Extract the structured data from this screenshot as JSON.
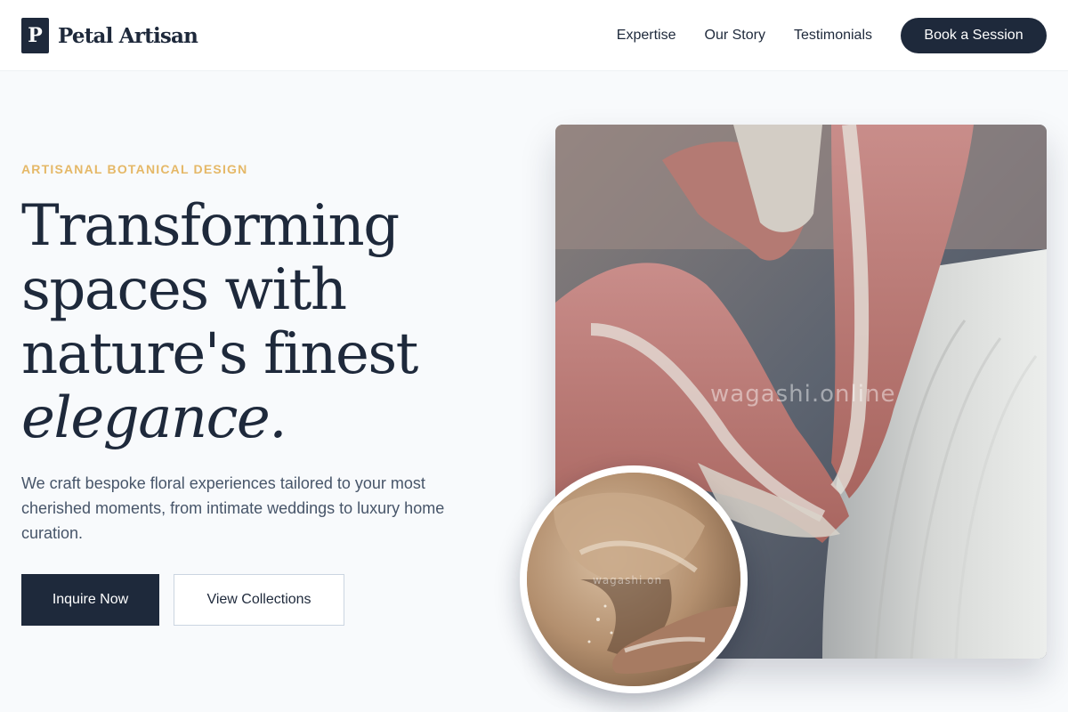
{
  "brand": {
    "logo_letter": "P",
    "name": "Petal Artisan"
  },
  "nav": {
    "links": [
      "Expertise",
      "Our Story",
      "Testimonials"
    ],
    "cta_label": "Book a Session"
  },
  "hero": {
    "eyebrow": "ARTISANAL BOTANICAL DESIGN",
    "headline_lines": [
      "Transforming",
      "spaces with",
      "nature's finest"
    ],
    "headline_emphasis": "elegance.",
    "lead": "We craft bespoke floral experiences tailored to your most cherished moments, from intimate weddings to luxury home curation.",
    "primary_button": "Inquire Now",
    "secondary_button": "View Collections",
    "main_image_watermark": "wagashi.online",
    "inset_image_watermark": "wagashi.on"
  },
  "colors": {
    "primary": "#1e293b",
    "accent": "#e5b867",
    "background": "#f8fafc",
    "muted_text": "#475569"
  }
}
